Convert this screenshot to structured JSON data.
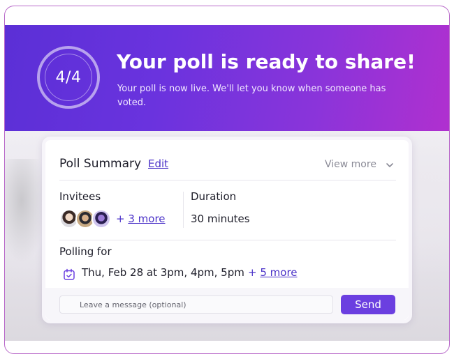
{
  "hero": {
    "progress_text": "4/4",
    "progress": {
      "current": 4,
      "total": 4
    },
    "title": "Your poll is ready to share!",
    "subtitle": "Your poll is now live. We'll let you know when someone has voted."
  },
  "summary": {
    "title": "Poll Summary",
    "edit_label": "Edit",
    "view_more_label": "View more",
    "invitees": {
      "label": "Invitees",
      "more_prefix": "+ ",
      "more_label": "3 more"
    },
    "duration": {
      "label": "Duration",
      "value": "30 minutes"
    },
    "polling": {
      "label": "Polling for",
      "value": "Thu, Feb 28 at 3pm, 4pm, 5pm",
      "more_prefix": "+ ",
      "more_label": "5 more"
    }
  },
  "message": {
    "placeholder": "Leave a message (optional)",
    "value": ""
  },
  "send_label": "Send",
  "icons": [
    "chevron-down-icon",
    "calendar-icon",
    "mail-icon"
  ],
  "colors": {
    "accent": "#6b3fe0",
    "link": "#4a31c8",
    "hero_start": "#5b2fd6",
    "hero_end": "#b030cf"
  }
}
